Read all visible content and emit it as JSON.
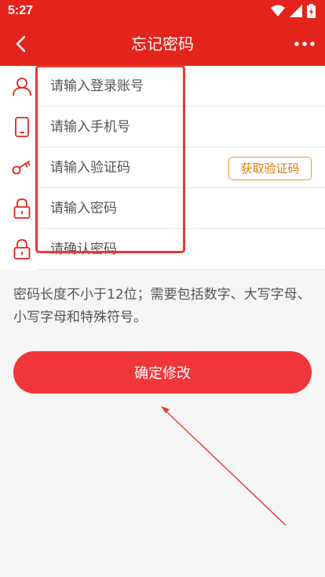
{
  "status_bar": {
    "time": "5:27"
  },
  "header": {
    "title": "忘记密码"
  },
  "form": {
    "account_placeholder": "请输入登录账号",
    "phone_placeholder": "请输入手机号",
    "code_placeholder": "请输入验证码",
    "get_code_label": "获取验证码",
    "password_placeholder": "请输入密码",
    "confirm_placeholder": "请确认密码"
  },
  "hint": "密码长度不小于12位；需要包括数字、大写字母、小写字母和特殊符号。",
  "submit_label": "确定修改",
  "colors": {
    "brand_red": "#e4241c",
    "button_red": "#f0353b",
    "code_button_orange": "#e07a10",
    "annotation_red": "#e53a31"
  },
  "icons": [
    "back-arrow-icon",
    "more-dots-icon",
    "user-icon",
    "phone-icon",
    "key-icon",
    "lock-icon",
    "wifi-icon",
    "signal-icon",
    "battery-icon"
  ]
}
